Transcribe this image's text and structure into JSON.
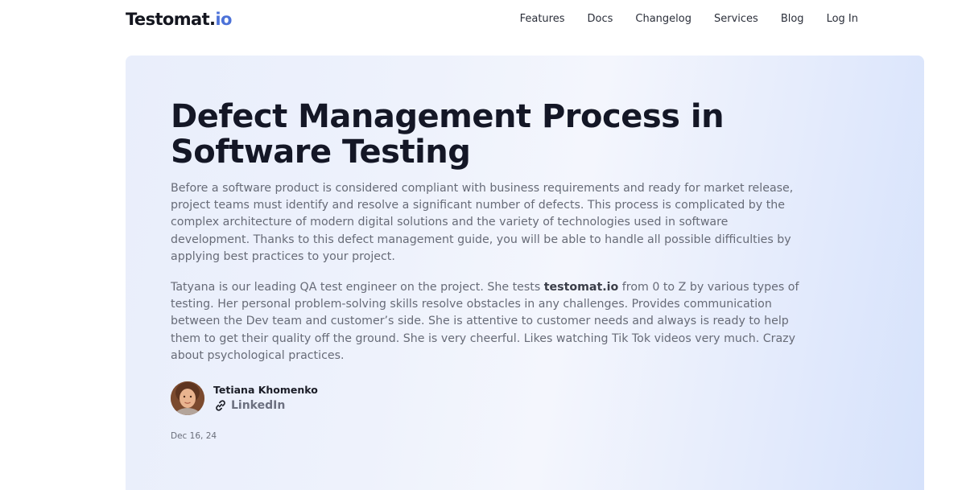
{
  "header": {
    "logo_main": "Testomat.",
    "logo_tld": "io",
    "nav": [
      "Features",
      "Docs",
      "Changelog",
      "Services",
      "Blog",
      "Log In"
    ]
  },
  "article": {
    "title": "Defect Management Process in Software Testing",
    "intro": "Before a software product is considered compliant with business requirements and ready for market release, project teams must identify and resolve a significant number of defects. This process is complicated by the complex architecture of modern digital solutions and the variety of technologies used in software development. Thanks to this defect management guide, you will be able to handle all possible difficulties by applying best practices to your project.",
    "bio_before": "Tatyana is our leading QA test engineer on the project. She tests ",
    "bio_brand": "testomat.io",
    "bio_after": " from 0 to Z by various types of testing. Her personal problem-solving skills resolve obstacles in any challenges. Provides communication between the Dev team and customer’s side. She is attentive to customer needs and always is ready to help them to get their quality off the ground. She is very cheerful. Likes watching Tik Tok videos very much. Crazy about psychological practices.",
    "author": {
      "name": "Tetiana Khomenko",
      "link_label": "LinkedIn"
    },
    "date": "Dec 16, 24"
  },
  "colors": {
    "brand_accent": "#4c72d8",
    "title": "#141726",
    "body_text": "#676b77"
  },
  "icons": {
    "link": "link-icon",
    "avatar": "author-avatar"
  }
}
